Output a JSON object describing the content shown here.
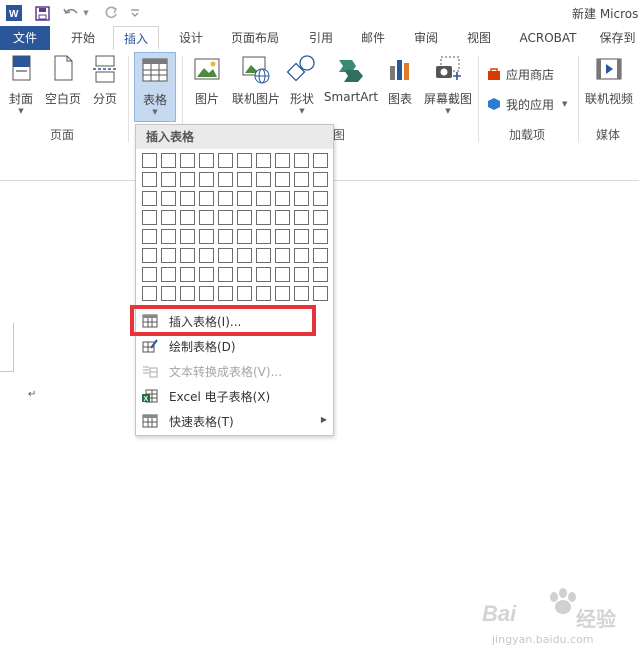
{
  "window": {
    "title": "新建 Micros"
  },
  "tabs": [
    {
      "label": "文件",
      "kind": "file"
    },
    {
      "label": "开始"
    },
    {
      "label": "插入",
      "active": true
    },
    {
      "label": "设计"
    },
    {
      "label": "页面布局"
    },
    {
      "label": "引用"
    },
    {
      "label": "邮件"
    },
    {
      "label": "审阅"
    },
    {
      "label": "视图"
    },
    {
      "label": "ACROBAT"
    },
    {
      "label": "保存到"
    }
  ],
  "ribbon": {
    "pages": {
      "cover": "封面",
      "blank": "空白页",
      "break": "分页",
      "group": "页面"
    },
    "table": {
      "label": "表格"
    },
    "illustrations": {
      "picture": "图片",
      "online_picture": "联机图片",
      "shapes": "形状",
      "smartart": "SmartArt",
      "chart": "图表",
      "screenshot": "屏幕截图",
      "group_fragment": "图"
    },
    "addins": {
      "store": "应用商店",
      "myapps": "我的应用",
      "group": "加载项"
    },
    "media": {
      "online_video": "联机视频",
      "group": "媒体"
    }
  },
  "dropdown": {
    "header": "插入表格",
    "grid": {
      "columns": 10,
      "rows": 8
    },
    "items": [
      {
        "label": "插入表格(I)...",
        "icon": "table-icon",
        "enabled": true
      },
      {
        "label": "绘制表格(D)",
        "icon": "draw-table-icon",
        "enabled": true
      },
      {
        "label": "文本转换成表格(V)...",
        "icon": "convert-text-icon",
        "enabled": false
      },
      {
        "label": "Excel 电子表格(X)",
        "icon": "excel-icon",
        "enabled": true
      },
      {
        "label": "快速表格(T)",
        "icon": "quick-table-icon",
        "enabled": true,
        "submenu": true
      }
    ]
  },
  "document": {
    "paragraph_mark": "↵"
  },
  "watermark": {
    "brand": "Bai",
    "brand2": "经验",
    "url": "jingyan.baidu.com"
  },
  "colors": {
    "accent": "#2b579a",
    "highlight": "#e8333b"
  }
}
